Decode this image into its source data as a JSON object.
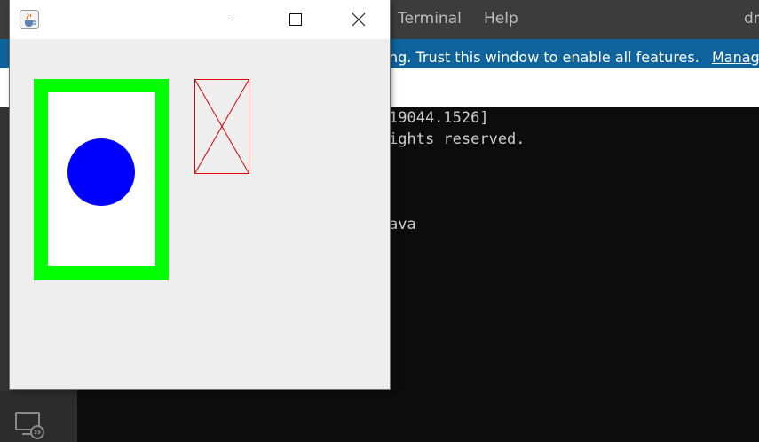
{
  "background": {
    "menu": [
      "Terminal",
      "Help"
    ],
    "title_fragment": "dr",
    "banner": {
      "text": "ng. Trust this window to enable all features.",
      "link": "Manag"
    },
    "terminal": {
      "lines": [
        "19044.1526]",
        "ights reserved.",
        "ava"
      ]
    },
    "remote_icon": "remote-explorer-icon",
    "colors": {
      "menubar": "#3c3c3c",
      "banner": "#0e639c",
      "terminal_bg": "#0c0c0c",
      "activity_bar": "#333333"
    }
  },
  "java_window": {
    "app_icon": "java-cup-icon",
    "controls": [
      "minimize-icon",
      "maximize-icon",
      "close-icon"
    ],
    "canvas": {
      "frame_color": "#00ff00",
      "panel_color": "#ffffff",
      "circle_color": "#0000ff",
      "placeholder_color": "#e00000"
    }
  }
}
